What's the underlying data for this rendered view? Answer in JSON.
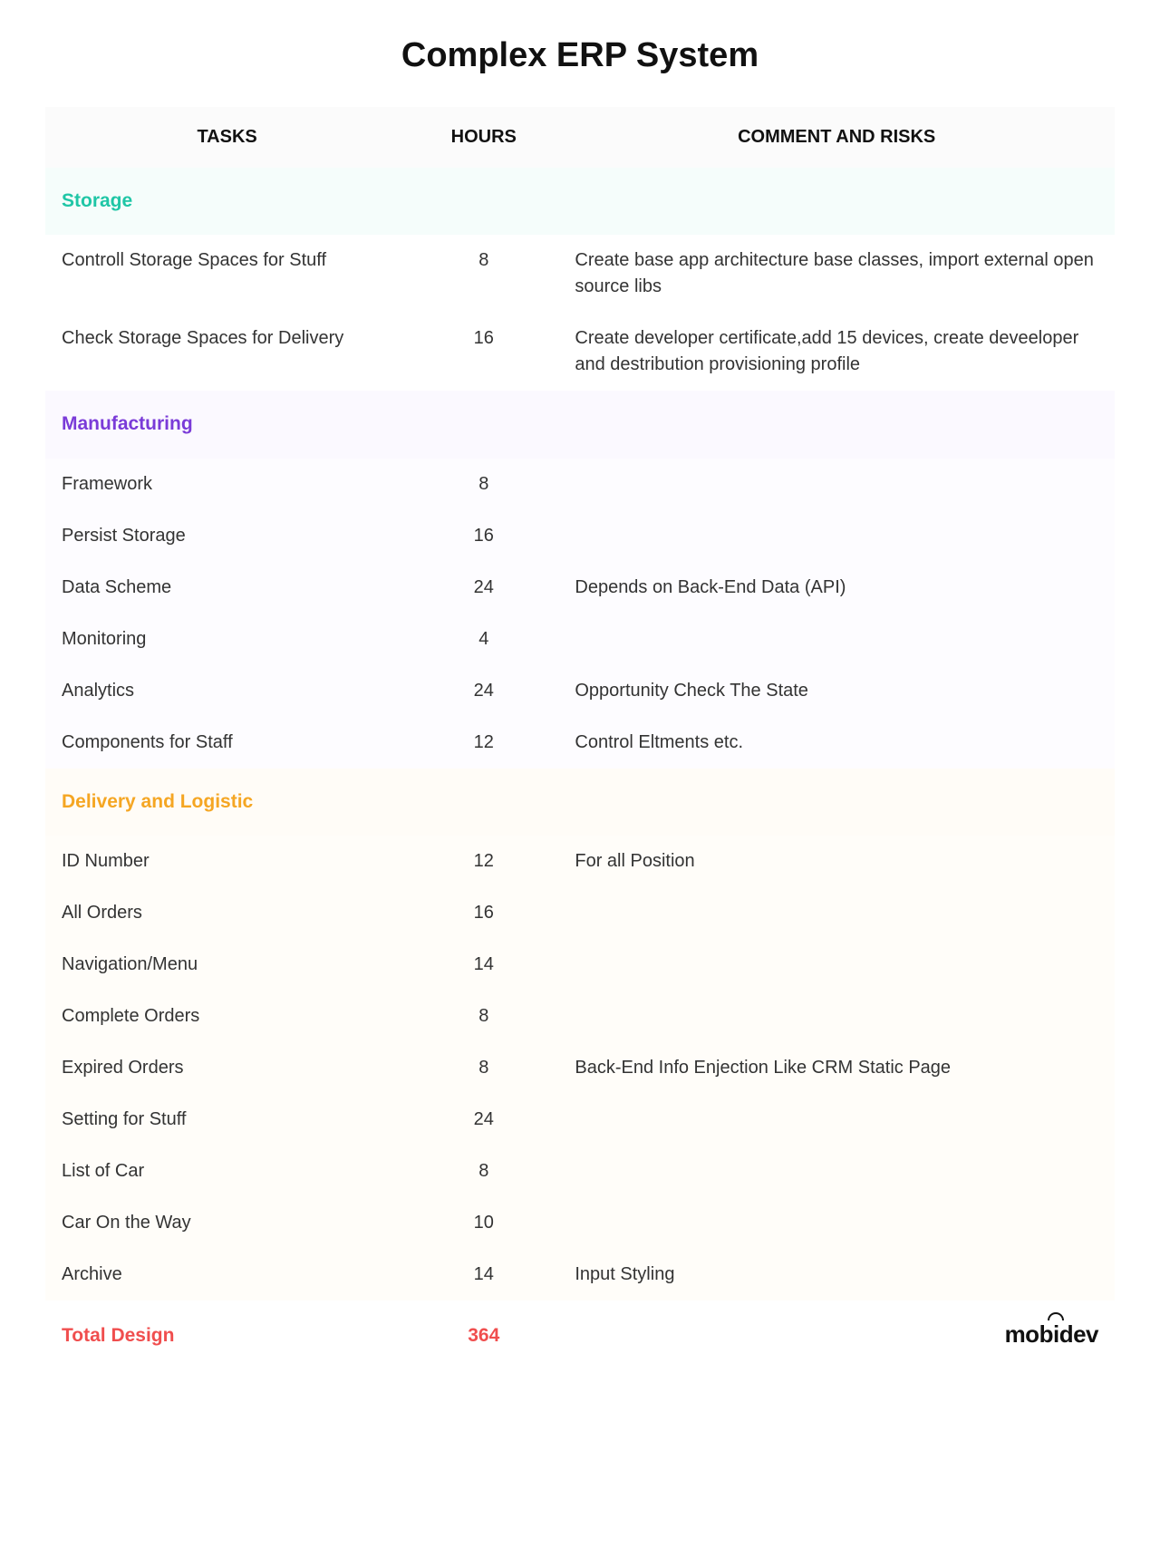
{
  "title": "Complex ERP System",
  "columns": {
    "tasks": "Tasks",
    "hours": "Hours",
    "comment": "Comment and Risks"
  },
  "sections": [
    {
      "id": "storage",
      "label": "Storage",
      "rows": [
        {
          "task": "Controll Storage Spaces for Stuff",
          "hours": "8",
          "comment": "Create base app architecture base classes, import external open source libs"
        },
        {
          "task": "Check Storage Spaces for Delivery",
          "hours": "16",
          "comment": "Create developer certificate,add 15 devices, create deveeloper and destribution provisioning profile"
        }
      ]
    },
    {
      "id": "manufacturing",
      "label": "Manufacturing",
      "rows": [
        {
          "task": "Framework",
          "hours": "8",
          "comment": ""
        },
        {
          "task": "Persist Storage",
          "hours": "16",
          "comment": ""
        },
        {
          "task": "Data Scheme",
          "hours": "24",
          "comment": "Depends on Back-End Data (API)"
        },
        {
          "task": "Monitoring",
          "hours": "4",
          "comment": ""
        },
        {
          "task": "Analytics",
          "hours": "24",
          "comment": "Opportunity Check The State"
        },
        {
          "task": "Components for Staff",
          "hours": "12",
          "comment": "Control Eltments etc."
        }
      ]
    },
    {
      "id": "delivery",
      "label": "Delivery and Logistic",
      "rows": [
        {
          "task": "ID Number",
          "hours": "12",
          "comment": "For all Position"
        },
        {
          "task": "All Orders",
          "hours": "16",
          "comment": ""
        },
        {
          "task": "Navigation/Menu",
          "hours": "14",
          "comment": ""
        },
        {
          "task": "Complete Orders",
          "hours": "8",
          "comment": ""
        },
        {
          "task": "Expired Orders",
          "hours": "8",
          "comment": "Back-End Info Enjection Like CRM Static Page"
        },
        {
          "task": "Setting for Stuff",
          "hours": "24",
          "comment": ""
        },
        {
          "task": "List of Car",
          "hours": "8",
          "comment": ""
        },
        {
          "task": "Car On the Way",
          "hours": "10",
          "comment": ""
        },
        {
          "task": "Archive",
          "hours": "14",
          "comment": "Input Styling"
        }
      ]
    }
  ],
  "total": {
    "label": "Total Design",
    "hours": "364"
  },
  "logo": {
    "text_before": "mob",
    "text_mid": "i",
    "text_after": "dev"
  }
}
